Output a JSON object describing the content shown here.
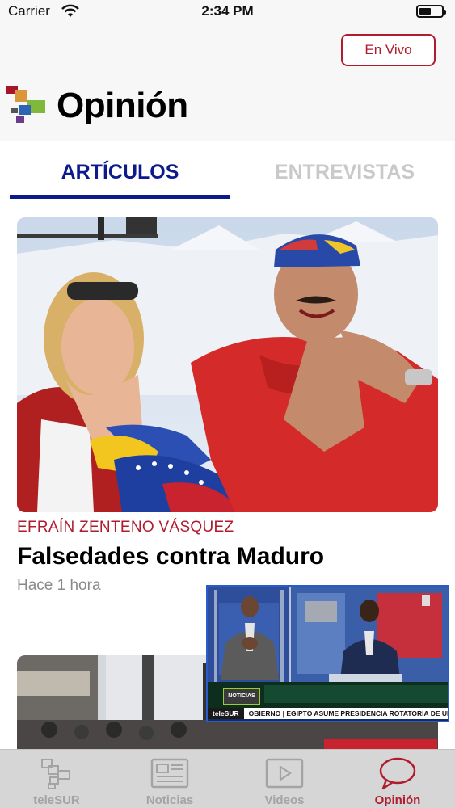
{
  "status_bar": {
    "carrier": "Carrier",
    "time": "2:34 PM"
  },
  "header": {
    "live_button_label": "En Vivo",
    "title": "Opinión"
  },
  "tabs": [
    {
      "label": "ARTÍCULOS",
      "active": true
    },
    {
      "label": "ENTREVISTAS",
      "active": false
    }
  ],
  "articles": [
    {
      "author": "EFRAÍN ZENTENO VÁSQUEZ",
      "title": "Falsedades contra Maduro",
      "time": "Hace 1 hora"
    }
  ],
  "video_player": {
    "badge": "NOTICIAS",
    "ticker_label": "teleSUR",
    "ticker_text": "OBIERNO  |  EGIPTO ASUME PRESIDENCIA ROTATORIA DE UNIÓN AFRICANA  |  Se"
  },
  "tab_bar": [
    {
      "label": "teleSUR",
      "icon": "telesur-icon",
      "active": false
    },
    {
      "label": "Noticias",
      "icon": "newspaper-icon",
      "active": false
    },
    {
      "label": "Videos",
      "icon": "play-icon",
      "active": false
    },
    {
      "label": "Opinión",
      "icon": "speech-bubble-icon",
      "active": true
    }
  ],
  "colors": {
    "accent_red": "#b01c2e",
    "tab_blue": "#0c1a8c",
    "inactive_gray": "#a4a4a4"
  }
}
